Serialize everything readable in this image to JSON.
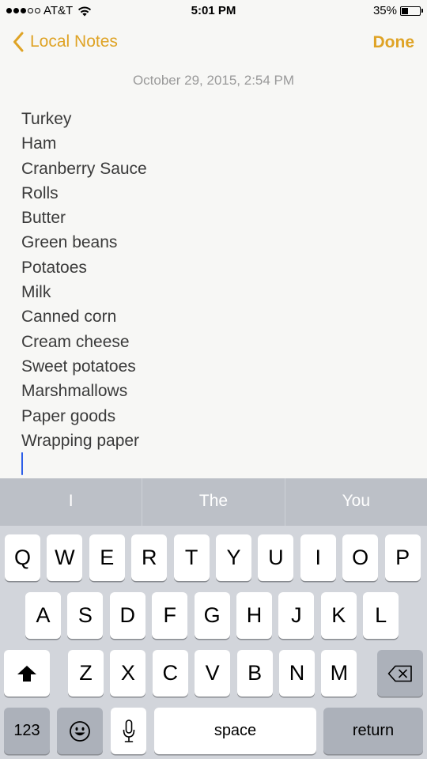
{
  "status_bar": {
    "signal_strength": {
      "filled": 3,
      "total": 5
    },
    "carrier": "AT&T",
    "wifi_icon": "wifi-icon",
    "time": "5:01 PM",
    "battery_percent_label": "35%",
    "battery_level": 0.35
  },
  "nav": {
    "back_label": "Local Notes",
    "back_icon": "chevron-left-icon",
    "done_label": "Done",
    "accent_color": "#dfa325"
  },
  "note": {
    "date": "October 29, 2015, 2:54 PM",
    "lines": [
      "Turkey",
      "Ham",
      "Cranberry Sauce",
      "Rolls",
      "Butter",
      "Green beans",
      "Potatoes",
      "Milk",
      "Canned corn",
      "Cream cheese",
      "Sweet potatoes",
      "Marshmallows",
      "Paper goods",
      "Wrapping paper"
    ],
    "cursor_color": "#2c5ee8"
  },
  "keyboard": {
    "suggestions": [
      "I",
      "The",
      "You"
    ],
    "row1": [
      "Q",
      "W",
      "E",
      "R",
      "T",
      "Y",
      "U",
      "I",
      "O",
      "P"
    ],
    "row2": [
      "A",
      "S",
      "D",
      "F",
      "G",
      "H",
      "J",
      "K",
      "L"
    ],
    "row3": [
      "Z",
      "X",
      "C",
      "V",
      "B",
      "N",
      "M"
    ],
    "shift_icon": "shift-arrow-icon",
    "delete_icon": "backspace-icon",
    "numbers_label": "123",
    "emoji_icon": "emoji-icon",
    "mic_icon": "microphone-icon",
    "space_label": "space",
    "return_label": "return"
  }
}
